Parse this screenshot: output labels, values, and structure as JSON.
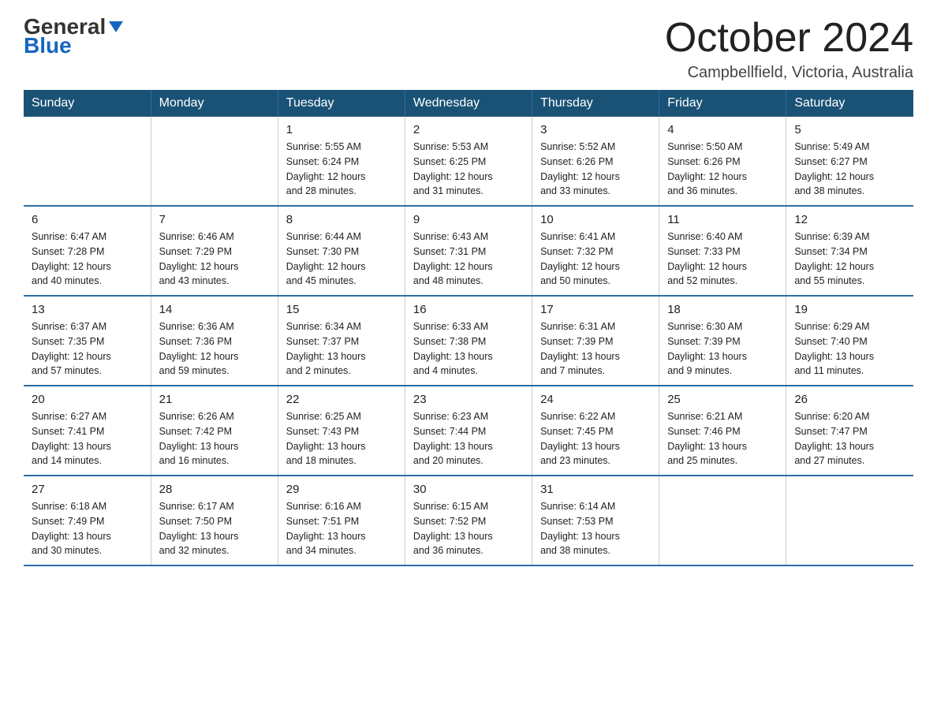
{
  "header": {
    "logo_general": "General",
    "logo_blue": "Blue",
    "month_title": "October 2024",
    "location": "Campbellfield, Victoria, Australia"
  },
  "days_of_week": [
    "Sunday",
    "Monday",
    "Tuesday",
    "Wednesday",
    "Thursday",
    "Friday",
    "Saturday"
  ],
  "weeks": [
    [
      {
        "day": "",
        "info": ""
      },
      {
        "day": "",
        "info": ""
      },
      {
        "day": "1",
        "info": "Sunrise: 5:55 AM\nSunset: 6:24 PM\nDaylight: 12 hours\nand 28 minutes."
      },
      {
        "day": "2",
        "info": "Sunrise: 5:53 AM\nSunset: 6:25 PM\nDaylight: 12 hours\nand 31 minutes."
      },
      {
        "day": "3",
        "info": "Sunrise: 5:52 AM\nSunset: 6:26 PM\nDaylight: 12 hours\nand 33 minutes."
      },
      {
        "day": "4",
        "info": "Sunrise: 5:50 AM\nSunset: 6:26 PM\nDaylight: 12 hours\nand 36 minutes."
      },
      {
        "day": "5",
        "info": "Sunrise: 5:49 AM\nSunset: 6:27 PM\nDaylight: 12 hours\nand 38 minutes."
      }
    ],
    [
      {
        "day": "6",
        "info": "Sunrise: 6:47 AM\nSunset: 7:28 PM\nDaylight: 12 hours\nand 40 minutes."
      },
      {
        "day": "7",
        "info": "Sunrise: 6:46 AM\nSunset: 7:29 PM\nDaylight: 12 hours\nand 43 minutes."
      },
      {
        "day": "8",
        "info": "Sunrise: 6:44 AM\nSunset: 7:30 PM\nDaylight: 12 hours\nand 45 minutes."
      },
      {
        "day": "9",
        "info": "Sunrise: 6:43 AM\nSunset: 7:31 PM\nDaylight: 12 hours\nand 48 minutes."
      },
      {
        "day": "10",
        "info": "Sunrise: 6:41 AM\nSunset: 7:32 PM\nDaylight: 12 hours\nand 50 minutes."
      },
      {
        "day": "11",
        "info": "Sunrise: 6:40 AM\nSunset: 7:33 PM\nDaylight: 12 hours\nand 52 minutes."
      },
      {
        "day": "12",
        "info": "Sunrise: 6:39 AM\nSunset: 7:34 PM\nDaylight: 12 hours\nand 55 minutes."
      }
    ],
    [
      {
        "day": "13",
        "info": "Sunrise: 6:37 AM\nSunset: 7:35 PM\nDaylight: 12 hours\nand 57 minutes."
      },
      {
        "day": "14",
        "info": "Sunrise: 6:36 AM\nSunset: 7:36 PM\nDaylight: 12 hours\nand 59 minutes."
      },
      {
        "day": "15",
        "info": "Sunrise: 6:34 AM\nSunset: 7:37 PM\nDaylight: 13 hours\nand 2 minutes."
      },
      {
        "day": "16",
        "info": "Sunrise: 6:33 AM\nSunset: 7:38 PM\nDaylight: 13 hours\nand 4 minutes."
      },
      {
        "day": "17",
        "info": "Sunrise: 6:31 AM\nSunset: 7:39 PM\nDaylight: 13 hours\nand 7 minutes."
      },
      {
        "day": "18",
        "info": "Sunrise: 6:30 AM\nSunset: 7:39 PM\nDaylight: 13 hours\nand 9 minutes."
      },
      {
        "day": "19",
        "info": "Sunrise: 6:29 AM\nSunset: 7:40 PM\nDaylight: 13 hours\nand 11 minutes."
      }
    ],
    [
      {
        "day": "20",
        "info": "Sunrise: 6:27 AM\nSunset: 7:41 PM\nDaylight: 13 hours\nand 14 minutes."
      },
      {
        "day": "21",
        "info": "Sunrise: 6:26 AM\nSunset: 7:42 PM\nDaylight: 13 hours\nand 16 minutes."
      },
      {
        "day": "22",
        "info": "Sunrise: 6:25 AM\nSunset: 7:43 PM\nDaylight: 13 hours\nand 18 minutes."
      },
      {
        "day": "23",
        "info": "Sunrise: 6:23 AM\nSunset: 7:44 PM\nDaylight: 13 hours\nand 20 minutes."
      },
      {
        "day": "24",
        "info": "Sunrise: 6:22 AM\nSunset: 7:45 PM\nDaylight: 13 hours\nand 23 minutes."
      },
      {
        "day": "25",
        "info": "Sunrise: 6:21 AM\nSunset: 7:46 PM\nDaylight: 13 hours\nand 25 minutes."
      },
      {
        "day": "26",
        "info": "Sunrise: 6:20 AM\nSunset: 7:47 PM\nDaylight: 13 hours\nand 27 minutes."
      }
    ],
    [
      {
        "day": "27",
        "info": "Sunrise: 6:18 AM\nSunset: 7:49 PM\nDaylight: 13 hours\nand 30 minutes."
      },
      {
        "day": "28",
        "info": "Sunrise: 6:17 AM\nSunset: 7:50 PM\nDaylight: 13 hours\nand 32 minutes."
      },
      {
        "day": "29",
        "info": "Sunrise: 6:16 AM\nSunset: 7:51 PM\nDaylight: 13 hours\nand 34 minutes."
      },
      {
        "day": "30",
        "info": "Sunrise: 6:15 AM\nSunset: 7:52 PM\nDaylight: 13 hours\nand 36 minutes."
      },
      {
        "day": "31",
        "info": "Sunrise: 6:14 AM\nSunset: 7:53 PM\nDaylight: 13 hours\nand 38 minutes."
      },
      {
        "day": "",
        "info": ""
      },
      {
        "day": "",
        "info": ""
      }
    ]
  ]
}
